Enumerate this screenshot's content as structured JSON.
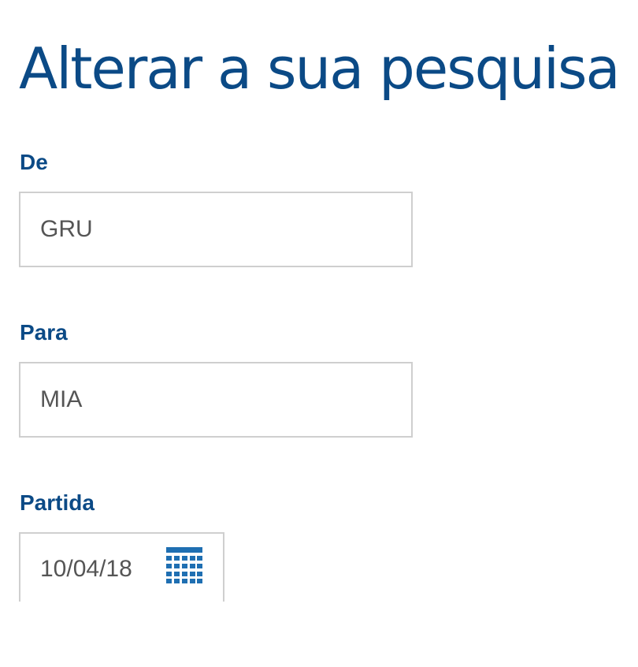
{
  "page": {
    "title": "Alterar a sua pesquisa"
  },
  "form": {
    "from": {
      "label": "De",
      "value": "GRU"
    },
    "to": {
      "label": "Para",
      "value": "MIA"
    },
    "departure": {
      "label": "Partida",
      "value": "10/04/18",
      "icon": "calendar-icon"
    }
  },
  "colors": {
    "brand": "#0b4a86",
    "input_border": "#cfcfcf",
    "input_text": "#555555",
    "calendar_icon": "#1f6fb2"
  }
}
